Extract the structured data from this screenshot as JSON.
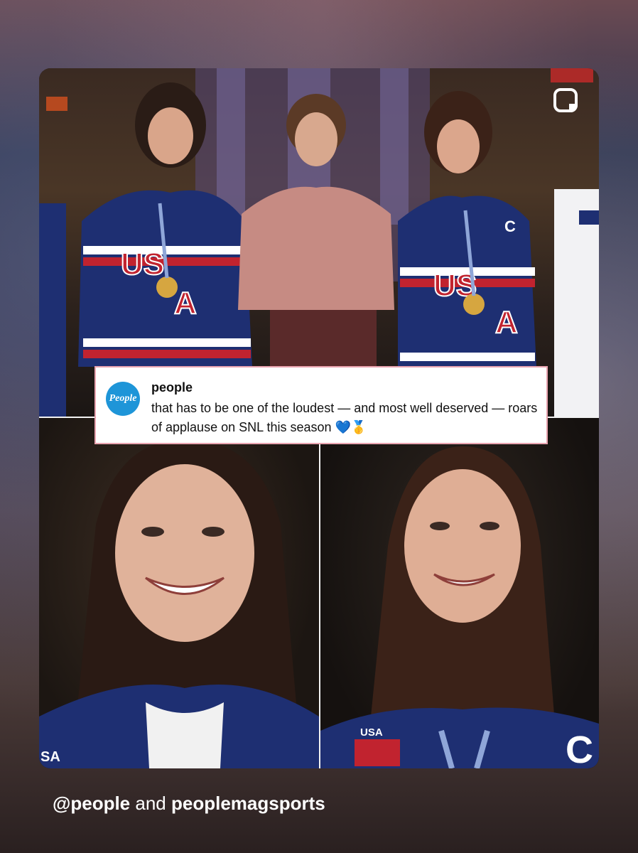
{
  "post": {
    "username": "people",
    "logo_text": "People",
    "caption_text": "that has to be one of the loudest — and most well deserved — roars of applause on SNL this season 💙🥇"
  },
  "footer": {
    "handle": "@people",
    "connector": " and ",
    "second_account": "peoplemagsports"
  },
  "icons": {
    "share": "instagram-icon"
  },
  "colors": {
    "people_blue": "#1e95d8",
    "caption_border": "#e9a4b0",
    "jersey_navy": "#1e2f72",
    "jersey_red": "#c1232f"
  },
  "photos": {
    "top_jersey_left_lines": [
      "US",
      "A"
    ],
    "top_jersey_right_lines": [
      "US",
      "A"
    ],
    "patch_text": "USA",
    "captain_letter": "C"
  }
}
